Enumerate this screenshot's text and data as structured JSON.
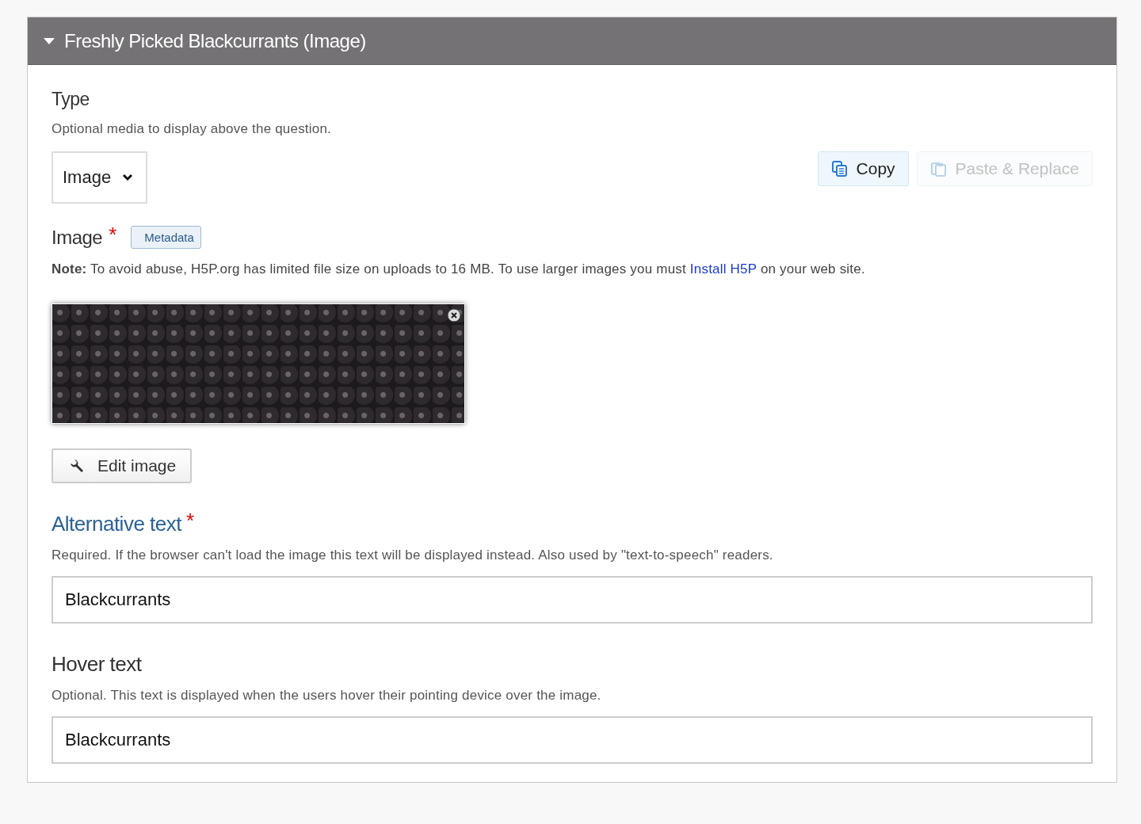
{
  "group": {
    "title": "Freshly Picked Blackcurrants (Image)",
    "expanded": true
  },
  "type_field": {
    "label": "Type",
    "description": "Optional media to display above the question.",
    "value": "Image"
  },
  "toolbar": [
    {
      "label": "Copy",
      "disabled": false
    },
    {
      "label": "Paste & Replace",
      "disabled": true
    }
  ],
  "image_field": {
    "label": "Image",
    "required_mark": "*",
    "metadata": "Metadata",
    "note_before": "**Note:** To avoid abuse, H5P.org has limited file size on uploads to 16 MB. To use larger images you must ",
    "note_link": "Install H5P",
    "note_after": " on your web site.",
    "edit_button": "Edit image"
  },
  "text_fields": [
    {
      "label": "Alternative text",
      "required_mark": "*",
      "focused": true,
      "description": "Required. If the browser can't load the image this text will be displayed instead. Also used by \"text-to-speech\" readers.",
      "value": "Blackcurrants"
    },
    {
      "label": "Hover text",
      "focused": false,
      "description": "Optional. This text is displayed when the users hover their pointing device over the image.",
      "value": "Blackcurrants"
    }
  ]
}
